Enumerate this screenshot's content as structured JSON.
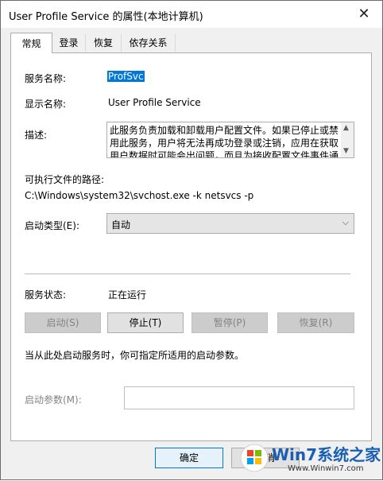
{
  "window": {
    "title": "User Profile Service 的属性(本地计算机)"
  },
  "tabs": [
    {
      "label": "常规"
    },
    {
      "label": "登录"
    },
    {
      "label": "恢复"
    },
    {
      "label": "依存关系"
    }
  ],
  "general": {
    "service_name_label": "服务名称:",
    "service_name_value": "ProfSvc",
    "display_name_label": "显示名称:",
    "display_name_value": "User Profile Service",
    "description_label": "描述:",
    "description_value": "此服务负责加载和卸载用户配置文件。如果已停止或禁用此服务，用户将无法再成功登录或注销，应用在获取用户数据时可能会出问题，而且为接收配置文件事件通",
    "exe_path_label": "可执行文件的路径:",
    "exe_path_value": "C:\\Windows\\system32\\svchost.exe -k netsvcs -p",
    "startup_type_label": "启动类型(E):",
    "startup_type_value": "自动",
    "status_label": "服务状态:",
    "status_value": "正在运行",
    "buttons": {
      "start": "启动(S)",
      "stop": "停止(T)",
      "pause": "暂停(P)",
      "resume": "恢复(R)"
    },
    "hint_text": "当从此处启动服务时，你可指定所适用的启动参数。",
    "start_params_label": "启动参数(M):",
    "start_params_value": ""
  },
  "footer": {
    "ok_label": "确定",
    "cancel_label": "取消"
  },
  "watermark": {
    "brand": "Win7系统之家",
    "url": "Www.Winwin7.com"
  },
  "background_chars": [
    "S",
    "C",
    "e",
    "b",
    "l",
    "o",
    "s",
    "y",
    "s",
    "s",
    "s",
    "t",
    "y",
    "e",
    "i",
    "i",
    "i",
    "i"
  ]
}
